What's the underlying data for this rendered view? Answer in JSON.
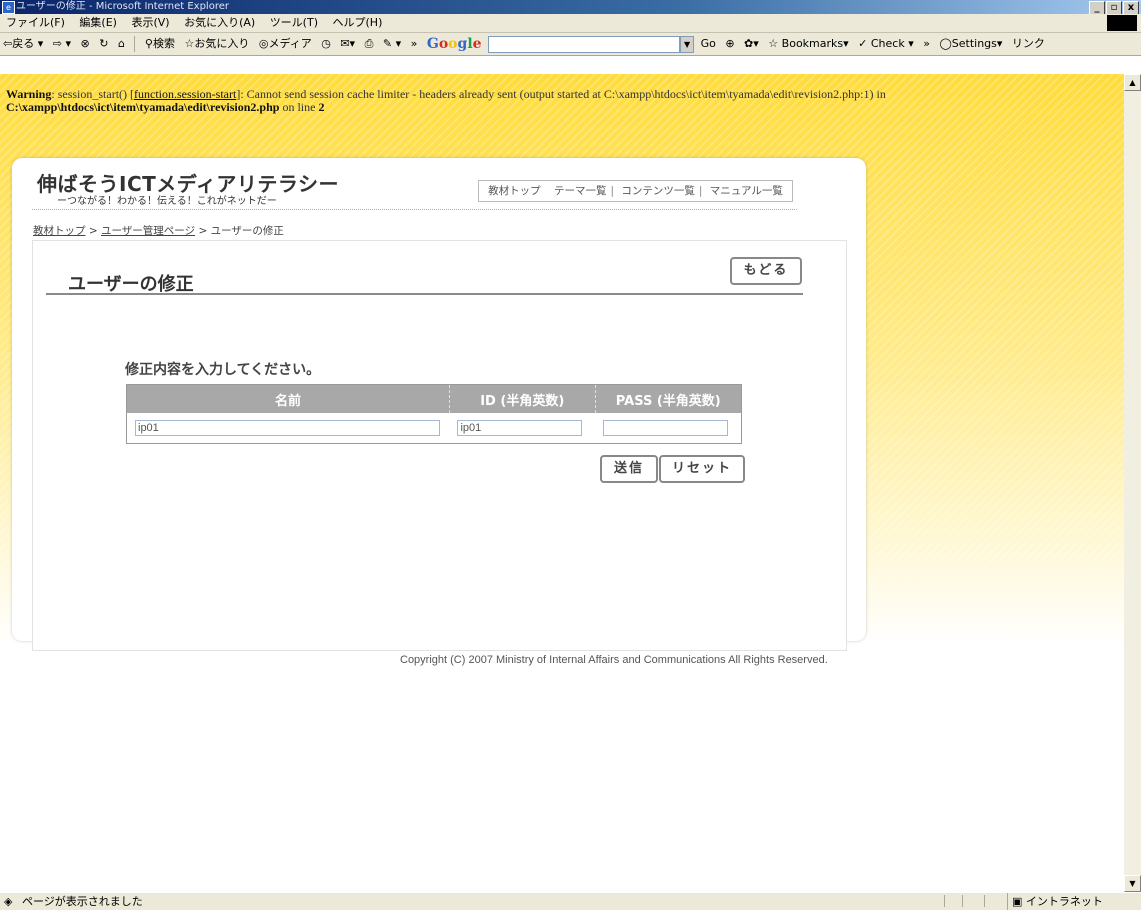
{
  "window": {
    "title": "ユーザーの修正 - Microsoft Internet Explorer",
    "controls": [
      "_",
      "▫",
      "x"
    ]
  },
  "menu": [
    "ファイル(F)",
    "編集(E)",
    "表示(V)",
    "お気に入り(A)",
    "ツール(T)",
    "ヘルプ(H)"
  ],
  "toolbar": {
    "back": "戻る",
    "search": "検索",
    "favorites": "お気に入り",
    "media": "メディア",
    "google_go": "Go",
    "bookmarks": "Bookmarks▾",
    "check": "Check ▾",
    "settings": "Settings▾",
    "links": "リンク"
  },
  "warning": {
    "label": "Warning",
    "text1": ": session_start() [",
    "link": "function.session-start",
    "text2": "]: Cannot send session cache limiter - headers already sent (output started at C:\\xampp\\htdocs\\ict\\item\\tyamada\\edit\\revision2.php:1) in",
    "path": "C:\\xampp\\htdocs\\ict\\item\\tyamada\\edit\\revision2.php",
    "line_text": " on line ",
    "line_num": "2"
  },
  "site": {
    "title": "伸ばそうICTメディアリテラシー",
    "subtitle": "ーつながる！わかる！伝える！これがネットだー",
    "nav": [
      "教材トップ",
      "テーマ一覧",
      "コンテンツ一覧",
      "マニュアル一覧"
    ]
  },
  "breadcrumb": {
    "items": [
      "教材トップ",
      "ユーザー管理ページ"
    ],
    "current": "ユーザーの修正",
    "separator": ">"
  },
  "page": {
    "heading": "ユーザーの修正",
    "back_label": "もどる",
    "instruction": "修正内容を入力してください。"
  },
  "form": {
    "headers": [
      "名前",
      "ID (半角英数)",
      "PASS (半角英数)"
    ],
    "name_value": "ip01",
    "id_value": "ip01",
    "pass_value": "",
    "submit_label": "送信",
    "reset_label": "リセット"
  },
  "copyright": "Copyright (C) 2007 Ministry of Internal Affairs and Communications All Rights Reserved.",
  "status": {
    "text": "ページが表示されました",
    "zone": "イントラネット"
  }
}
